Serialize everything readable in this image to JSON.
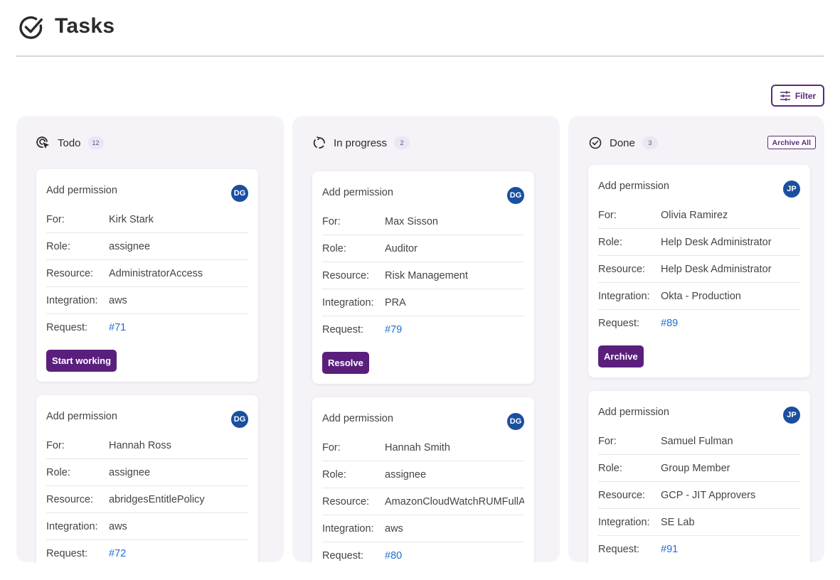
{
  "page": {
    "title": "Tasks"
  },
  "toolbar": {
    "filter_label": "Filter"
  },
  "columns": [
    {
      "title": "Todo",
      "count": "12",
      "cards": [
        {
          "title": "Add permission",
          "avatar": "DG",
          "for": "Kirk Stark",
          "role": "assignee",
          "resource": "AdministratorAccess",
          "integration": "aws",
          "request": "#71",
          "action": "Start working"
        },
        {
          "title": "Add permission",
          "avatar": "DG",
          "for": "Hannah Ross",
          "role": "assignee",
          "resource": "abridgesEntitlePolicy",
          "integration": "aws",
          "request": "#72"
        }
      ]
    },
    {
      "title": "In progress",
      "count": "2",
      "cards": [
        {
          "title": "Add permission",
          "avatar": "DG",
          "for": "Max Sisson",
          "role": "Auditor",
          "resource": "Risk Management",
          "integration": "PRA",
          "request": "#79",
          "action": "Resolve"
        },
        {
          "title": "Add permission",
          "avatar": "DG",
          "for": "Hannah Smith",
          "role": "assignee",
          "resource": "AmazonCloudWatchRUMFullAccess",
          "integration": "aws",
          "request": "#80"
        }
      ]
    },
    {
      "title": "Done",
      "count": "3",
      "archive_all": "Archive All",
      "cards": [
        {
          "title": "Add permission",
          "avatar": "JP",
          "for": "Olivia Ramirez",
          "role": "Help Desk Administrator",
          "resource": "Help Desk Administrator",
          "integration": "Okta - Production",
          "request": "#89",
          "action": "Archive"
        },
        {
          "title": "Add permission",
          "avatar": "JP",
          "for": "Samuel Fulman",
          "role": "Group Member",
          "resource": "GCP - JIT Approvers",
          "integration": "SE Lab",
          "request": "#91"
        }
      ]
    }
  ],
  "labels": {
    "for": "For:",
    "role": "Role:",
    "resource": "Resource:",
    "integration": "Integration:",
    "request": "Request:"
  },
  "colors": {
    "accent": "#5a1f7d",
    "avatar": "#1a4fa0",
    "link": "#1a6fd6",
    "column_bg": "#f5f3f7"
  }
}
